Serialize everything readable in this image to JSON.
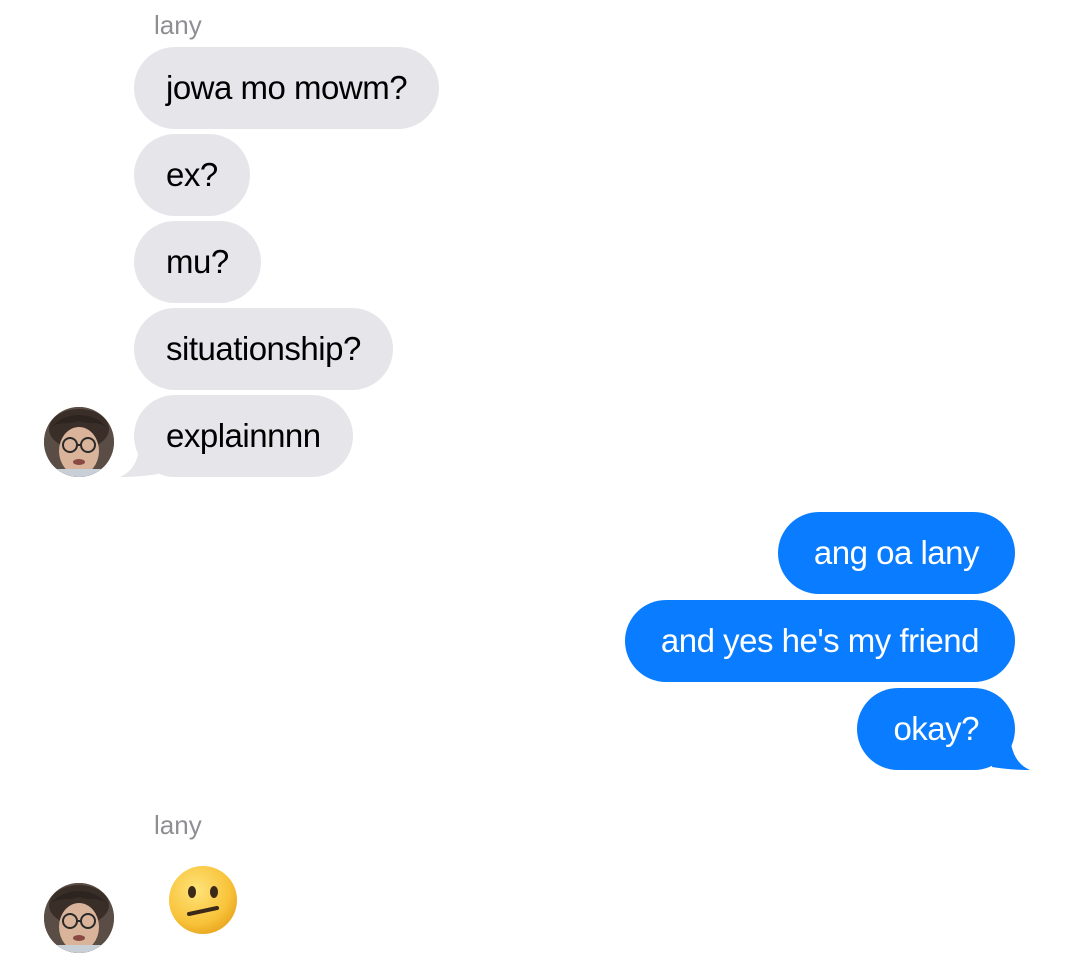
{
  "conversation": {
    "sender_name_1": "lany",
    "incoming_group_1": [
      {
        "text": "jowa mo mowm?"
      },
      {
        "text": "ex?"
      },
      {
        "text": "mu?"
      },
      {
        "text": "situationship?"
      },
      {
        "text": "explainnnn"
      }
    ],
    "outgoing_group": [
      {
        "text": "ang oa lany"
      },
      {
        "text": "and yes he's my friend"
      },
      {
        "text": "okay?"
      }
    ],
    "sender_name_2": "lany",
    "reaction_emoji_icon": "neutral-face-emoji",
    "avatar_icon": "contact-avatar-photo"
  },
  "colors": {
    "incoming_bubble": "#e5e5ea",
    "outgoing_bubble": "#0a7cff",
    "sender_name": "#8e8e93"
  }
}
